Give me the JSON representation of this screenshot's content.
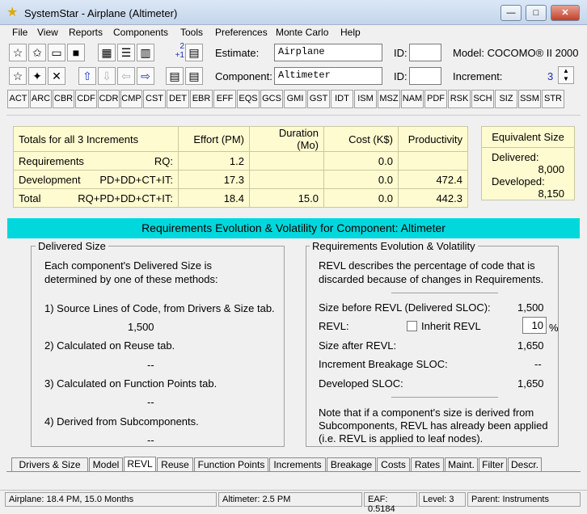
{
  "window": {
    "title": "SystemStar - Airplane (Altimeter)"
  },
  "menu": [
    "File",
    "View",
    "Reports",
    "Components",
    "Tools",
    "Preferences",
    "Monte Carlo",
    "Help"
  ],
  "toolbar": {
    "estimate_label": "Estimate:",
    "estimate_value": "Airplane",
    "component_label": "Component:",
    "component_value": "Altimeter",
    "id_label": "ID:",
    "model_text": "Model: COCOMO® II 2000",
    "increment_label": "Increment:",
    "increment_value": "3",
    "increment_badge_top": "2",
    "increment_badge_bottom": "+1"
  },
  "attribute_buttons": [
    "ACT",
    "ARC",
    "CBR",
    "CDF",
    "CDR",
    "CMP",
    "CST",
    "DET",
    "EBR",
    "EFF",
    "EQS",
    "GCS",
    "GMI",
    "GST",
    "IDT",
    "ISM",
    "MSZ",
    "NAM",
    "PDF",
    "RSK",
    "SCH",
    "SIZ",
    "SSM",
    "STR"
  ],
  "totals": {
    "header": [
      "Totals for all 3 Increments",
      "Effort (PM)",
      "Duration (Mo)",
      "Cost (K$)",
      "Productivity"
    ],
    "rows": [
      {
        "name": "Requirements",
        "formula": "RQ:",
        "effort": "1.2",
        "duration": "",
        "cost": "0.0",
        "productivity": ""
      },
      {
        "name": "Development",
        "formula": "PD+DD+CT+IT:",
        "effort": "17.3",
        "duration": "",
        "cost": "0.0",
        "productivity": "472.4"
      },
      {
        "name": "Total",
        "formula": "RQ+PD+DD+CT+IT:",
        "effort": "18.4",
        "duration": "15.0",
        "cost": "0.0",
        "productivity": "442.3"
      }
    ]
  },
  "equivalent_size": {
    "title": "Equivalent Size",
    "delivered_label": "Delivered:",
    "delivered_value": "8,000",
    "developed_label": "Developed:",
    "developed_value": "8,150"
  },
  "section_title": "Requirements Evolution & Volatility for Component: Altimeter",
  "delivered_size": {
    "title": "Delivered Size",
    "intro": [
      "Each component's Delivered Size is",
      "determined by one of these methods:"
    ],
    "m1": "1) Source Lines of Code, from Drivers & Size tab.",
    "m1_value": "1,500",
    "m2": "2) Calculated on Reuse tab.",
    "m2_value": "--",
    "m3": "3) Calculated on Function Points tab.",
    "m3_value": "--",
    "m4": "4) Derived from Subcomponents.",
    "m4_value": "--"
  },
  "revl": {
    "title": "Requirements Evolution & Volatility",
    "intro": [
      "REVL describes the percentage of code that is",
      "discarded because of changes in Requirements."
    ],
    "size_before_label": "Size before REVL (Delivered SLOC):",
    "size_before_value": "1,500",
    "revl_label": "REVL:",
    "inherit_label": "Inherit REVL",
    "revl_value": "10",
    "percent": "%",
    "size_after_label": "Size after REVL:",
    "size_after_value": "1,650",
    "breakage_label": "Increment Breakage SLOC:",
    "breakage_value": "--",
    "developed_label": "Developed SLOC:",
    "developed_value": "1,650",
    "note": [
      "Note that if a component's size is derived from",
      "Subcomponents, REVL has already been applied",
      "(i.e. REVL is applied to leaf nodes)."
    ]
  },
  "tabs": [
    "Drivers & Size",
    "Model",
    "REVL",
    "Reuse",
    "Function Points",
    "Increments",
    "Breakage",
    "Costs",
    "Rates",
    "Maint.",
    "Filter",
    "Descr."
  ],
  "status": {
    "estimate": "Airplane:  18.4 PM,  15.0 Months",
    "component": "Altimeter:  2.5 PM",
    "eaf": "EAF: 0.5184",
    "level": "Level:   3",
    "parent": "Parent: Instruments"
  }
}
